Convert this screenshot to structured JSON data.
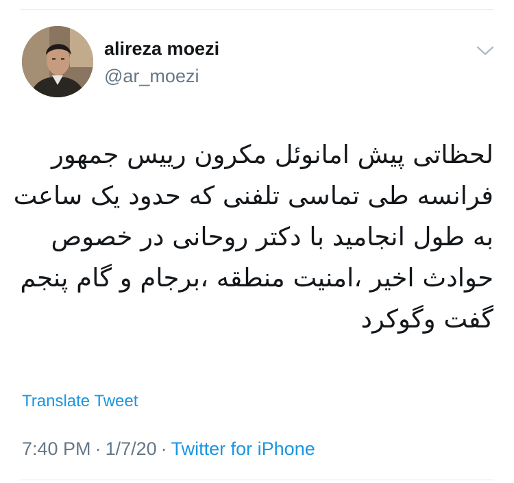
{
  "author": {
    "display_name": "alireza moezi",
    "handle": "@ar_moezi",
    "avatar": "profile-photo"
  },
  "menu": {
    "icon": "chevron-down-icon"
  },
  "tweet": {
    "lines": [
      "لحظاتی پیش امانوئل مکرون رییس جمهور",
      "فرانسه طی تماسی تلفنی که حدود یک ساعت",
      "به طول انجامید با دکتر روحانی در خصوص",
      "حوادث اخیر ،امنیت منطقه ،برجام و گام پنجم",
      "گفت وگوکرد"
    ]
  },
  "translate_label": "Translate Tweet",
  "meta": {
    "time": "7:40 PM",
    "separator": "·",
    "date": "1/7/20",
    "source": "Twitter for iPhone"
  },
  "colors": {
    "link": "#1b95e0",
    "secondary": "#657786",
    "divider": "#e1e8ed"
  }
}
